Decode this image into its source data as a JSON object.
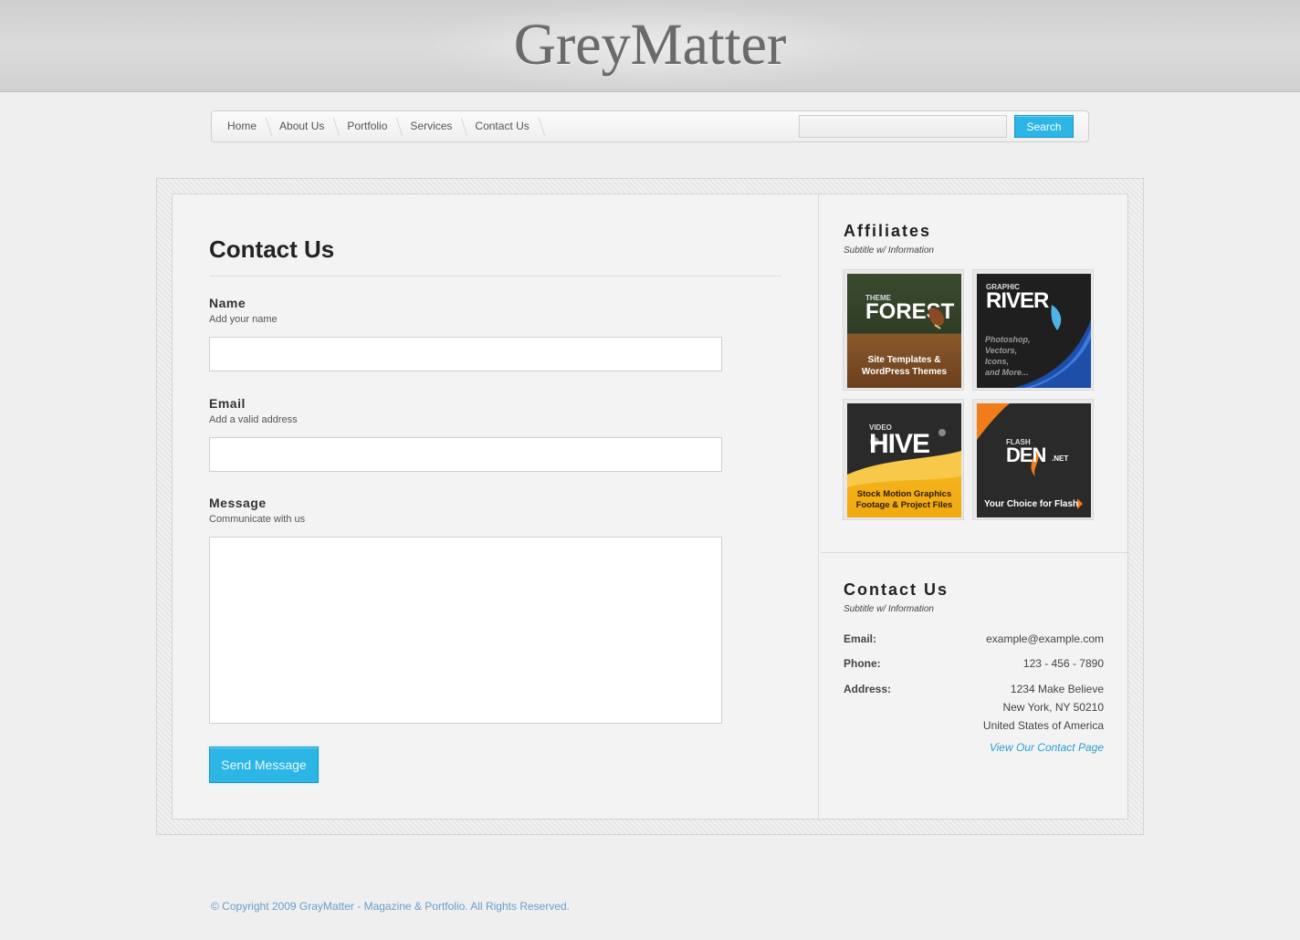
{
  "header": {
    "logo": "GreyMatter"
  },
  "nav": {
    "items": [
      {
        "label": "Home"
      },
      {
        "label": "About Us"
      },
      {
        "label": "Portfolio"
      },
      {
        "label": "Services"
      },
      {
        "label": "Contact Us"
      }
    ],
    "search_value": "",
    "search_button": "Search"
  },
  "form": {
    "title": "Contact Us",
    "name": {
      "label": "Name",
      "hint": "Add your name",
      "value": ""
    },
    "email": {
      "label": "Email",
      "hint": "Add a valid address",
      "value": ""
    },
    "message": {
      "label": "Message",
      "hint": "Communicate with us",
      "value": ""
    },
    "submit": "Send Message"
  },
  "sidebar": {
    "affiliates": {
      "title": "Affiliates",
      "subtitle": "Subtitle w/ Information",
      "banners": {
        "themeforest": {
          "small": "THEME",
          "big": "FOREST",
          "caption": "Site Templates & WordPress Themes"
        },
        "graphicriver": {
          "small": "GRAPHIC",
          "big": "RIVER",
          "lines": [
            "Photoshop,",
            "Vectors,",
            "Icons,",
            "and More..."
          ]
        },
        "videohive": {
          "small": "VIDEO",
          "big": "HIVE",
          "caption": "Stock Motion Graphics Footage & Project Files"
        },
        "flashden": {
          "small": "FLASH",
          "big": "DEN",
          "suffix": ".NET",
          "caption": "Your Choice for Flash"
        }
      }
    },
    "contact": {
      "title": "Contact Us",
      "subtitle": "Subtitle w/ Information",
      "email_label": "Email:",
      "email": "example@example.com",
      "phone_label": "Phone:",
      "phone": "123 - 456 - 7890",
      "address_label": "Address:",
      "address_lines": [
        "1234 Make Believe",
        "New York, NY 50210",
        "United States of America"
      ],
      "link": "View Our Contact Page"
    }
  },
  "footer": {
    "text": "© Copyright 2009 GrayMatter - Magazine & Portfolio. All Rights Reserved."
  },
  "colors": {
    "accent": "#2bb6e6",
    "footer_text": "#6a9ec8",
    "link": "#2a9fd0"
  }
}
